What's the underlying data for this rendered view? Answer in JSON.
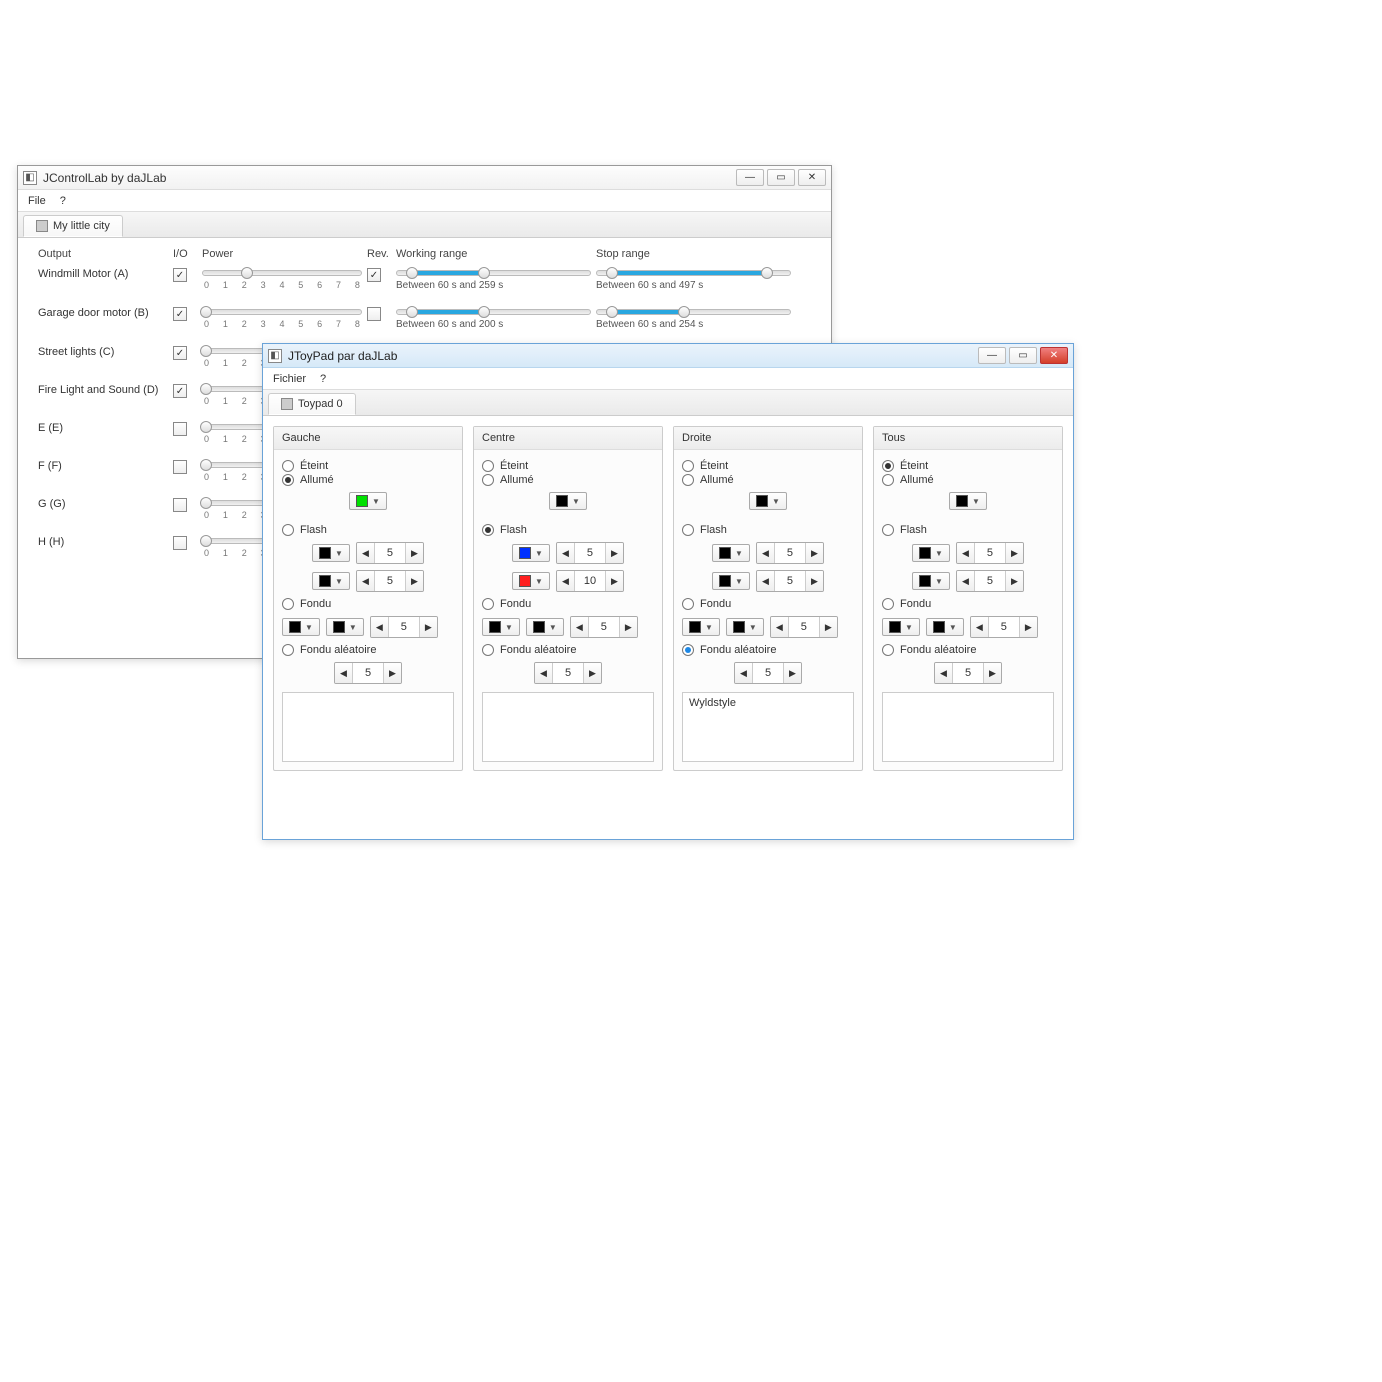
{
  "win1": {
    "title": "JControlLab by daJLab",
    "menu": {
      "file": "File",
      "help": "?"
    },
    "tab": "My little city",
    "headers": {
      "output": "Output",
      "io": "I/O",
      "power": "Power",
      "rev": "Rev.",
      "working": "Working range",
      "stop": "Stop range"
    },
    "ticks": [
      "0",
      "1",
      "2",
      "3",
      "4",
      "5",
      "6",
      "7",
      "8"
    ],
    "rows": [
      {
        "label": "Windmill Motor (A)",
        "io": true,
        "rev": true,
        "wlabel": "Between 60 s and 259 s",
        "slabel": "Between 60 s and 497 s"
      },
      {
        "label": "Garage door motor (B)",
        "io": true,
        "rev": false,
        "wlabel": "Between 60 s and 200 s",
        "slabel": "Between 60 s and 254 s"
      },
      {
        "label": "Street lights (C)",
        "io": true,
        "rev": null,
        "wlabel": "",
        "slabel": ""
      },
      {
        "label": "Fire Light and Sound (D)",
        "io": true,
        "rev": null,
        "wlabel": "",
        "slabel": ""
      },
      {
        "label": "E (E)",
        "io": false,
        "rev": null,
        "wlabel": "",
        "slabel": ""
      },
      {
        "label": "F (F)",
        "io": false,
        "rev": null,
        "wlabel": "",
        "slabel": ""
      },
      {
        "label": "G (G)",
        "io": false,
        "rev": null,
        "wlabel": "",
        "slabel": ""
      },
      {
        "label": "H (H)",
        "io": false,
        "rev": null,
        "wlabel": "",
        "slabel": ""
      }
    ]
  },
  "win2": {
    "title": "JToyPad par daJLab",
    "menu": {
      "file": "Fichier",
      "help": "?"
    },
    "tab": "Toypad 0",
    "labels": {
      "gauche": "Gauche",
      "centre": "Centre",
      "droite": "Droite",
      "tous": "Tous",
      "eteint": "Éteint",
      "allume": "Allumé",
      "flash": "Flash",
      "fondu": "Fondu",
      "fondu_aleatoire": "Fondu aléatoire"
    },
    "panels": {
      "gauche": {
        "mode": "allume",
        "allume_color": "#00e000",
        "flash": {
          "c1": "#000",
          "v1": "5",
          "c2": "#000",
          "v2": "5"
        },
        "fondu": {
          "c1": "#000",
          "c2": "#000",
          "v": "5"
        },
        "random": "5",
        "text": ""
      },
      "centre": {
        "mode": "flash",
        "allume_color": "#000",
        "flash": {
          "c1": "#0030ff",
          "v1": "5",
          "c2": "#ff1f1f",
          "v2": "10"
        },
        "fondu": {
          "c1": "#000",
          "c2": "#000",
          "v": "5"
        },
        "random": "5",
        "text": ""
      },
      "droite": {
        "mode": "fondu_aleatoire",
        "allume_color": "#000",
        "flash": {
          "c1": "#000",
          "v1": "5",
          "c2": "#000",
          "v2": "5"
        },
        "fondu": {
          "c1": "#000",
          "c2": "#000",
          "v": "5"
        },
        "random": "5",
        "text": "Wyldstyle"
      },
      "tous": {
        "mode": "eteint",
        "allume_color": "#000",
        "flash": {
          "c1": "#000",
          "v1": "5",
          "c2": "#000",
          "v2": "5"
        },
        "fondu": {
          "c1": "#000",
          "c2": "#000",
          "v": "5"
        },
        "random": "5",
        "text": ""
      }
    }
  }
}
